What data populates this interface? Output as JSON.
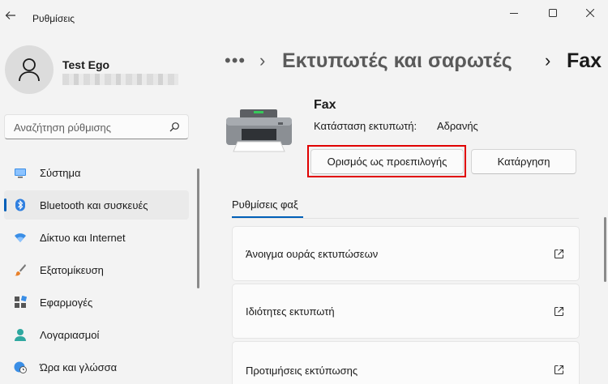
{
  "app": {
    "title": "Ρυθμίσεις"
  },
  "profile": {
    "name": "Test Ego"
  },
  "search": {
    "placeholder": "Αναζήτηση ρύθμισης"
  },
  "nav": {
    "items": [
      {
        "label": "Σύστημα",
        "icon": "system-icon"
      },
      {
        "label": "Bluetooth και συσκευές",
        "icon": "bluetooth-icon",
        "active": true
      },
      {
        "label": "Δίκτυο και Internet",
        "icon": "wifi-icon"
      },
      {
        "label": "Εξατομίκευση",
        "icon": "brush-icon"
      },
      {
        "label": "Εφαρμογές",
        "icon": "apps-icon"
      },
      {
        "label": "Λογαριασμοί",
        "icon": "account-icon"
      },
      {
        "label": "Ώρα και γλώσσα",
        "icon": "globe-clock-icon"
      }
    ]
  },
  "breadcrumb": {
    "more": "•••",
    "separator": "›",
    "parent": "Εκτυπωτές και σαρωτές",
    "current": "Fax"
  },
  "printer": {
    "name": "Fax",
    "status_label": "Κατάσταση εκτυπωτή:",
    "status_value": "Αδρανής",
    "set_default_label": "Ορισμός ως προεπιλογής",
    "remove_label": "Κατάργηση"
  },
  "tabs": [
    {
      "label": "Ρυθμίσεις φαξ"
    }
  ],
  "cards": [
    {
      "label": "Άνοιγμα ουράς εκτυπώσεων",
      "icon": "open-external-icon"
    },
    {
      "label": "Ιδιότητες εκτυπωτή",
      "icon": "open-external-icon"
    },
    {
      "label": "Προτιμήσεις εκτύπωσης",
      "icon": "open-external-icon"
    }
  ],
  "colors": {
    "accent": "#005fb8",
    "highlight": "#e00000",
    "background": "#f3f3f3"
  }
}
